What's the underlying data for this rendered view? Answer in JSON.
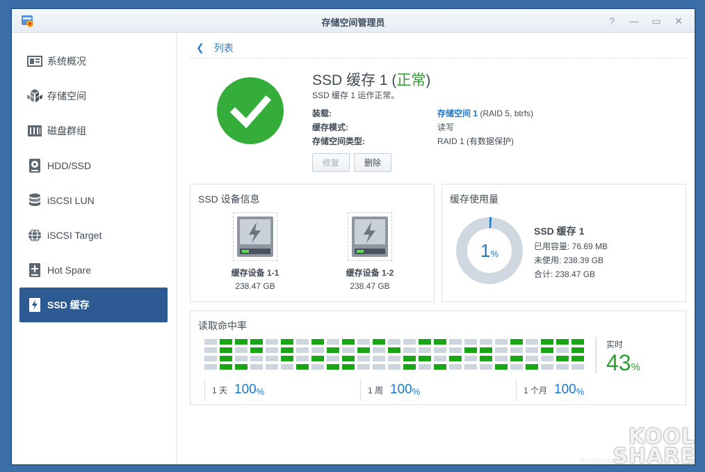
{
  "window": {
    "title": "存储空间管理员",
    "controls": [
      "?",
      "—",
      "▭",
      "✕"
    ]
  },
  "sidebar": {
    "items": [
      {
        "label": "系统概况",
        "icon": "overview-icon",
        "active": false
      },
      {
        "label": "存储空间",
        "icon": "cubes-icon",
        "active": false
      },
      {
        "label": "磁盘群组",
        "icon": "disk-group-icon",
        "active": false
      },
      {
        "label": "HDD/SSD",
        "icon": "hdd-icon",
        "active": false
      },
      {
        "label": "iSCSI LUN",
        "icon": "database-icon",
        "active": false
      },
      {
        "label": "iSCSI Target",
        "icon": "globe-icon",
        "active": false
      },
      {
        "label": "Hot Spare",
        "icon": "plus-box-icon",
        "active": false
      },
      {
        "label": "SSD 缓存",
        "icon": "ssd-cache-icon",
        "active": true
      }
    ]
  },
  "breadcrumb": {
    "back_label": "列表"
  },
  "header": {
    "title": "SSD 缓存 1",
    "status_open": " (",
    "status": "正常",
    "status_close": ")",
    "subtitle": "SSD 缓存 1 运作正常。",
    "rows": [
      {
        "label": "装载:",
        "value_link": "存储空间 1",
        "value": " (RAID 5, btrfs)"
      },
      {
        "label": "缓存模式:",
        "value_link": "",
        "value": "读写"
      },
      {
        "label": "存储空间类型:",
        "value_link": "",
        "value": "RAID 1 (有数据保护)"
      }
    ],
    "buttons": {
      "repair": "修复",
      "delete": "删除"
    }
  },
  "ssd_info": {
    "title": "SSD 设备信息",
    "disks": [
      {
        "name": "缓存设备 1-1",
        "size": "238.47 GB"
      },
      {
        "name": "缓存设备 1-2",
        "size": "238.47 GB"
      }
    ]
  },
  "cache_usage": {
    "title": "缓存使用量",
    "percent": "1",
    "percent_value": 1,
    "pct_sign": "%",
    "name": "SSD 缓存 1",
    "used": "已用容量: 76.69 MB",
    "unused": "未使用: 238.39 GB",
    "total": "合计: 238.47 GB"
  },
  "hit_rate": {
    "title": "读取命中率",
    "realtime_label": "实时",
    "realtime_value": "43",
    "pct_sign": "%",
    "periods": [
      {
        "label": "1 天",
        "value": "100",
        "pct": "%"
      },
      {
        "label": "1 周",
        "value": "100",
        "pct": "%"
      },
      {
        "label": "1 个月",
        "value": "100",
        "pct": "%"
      }
    ],
    "grid_rows": [
      "0111010101010011000010111",
      "0101010010101000011000101",
      "0100010101000110101010011",
      "0110001011000101000101000"
    ],
    "colors": {
      "hit": "#1aa516",
      "miss": "#cdd5de"
    }
  },
  "watermark": {
    "small": "koolshare.cn",
    "line1": "KOOL",
    "line2": "SHARE"
  }
}
